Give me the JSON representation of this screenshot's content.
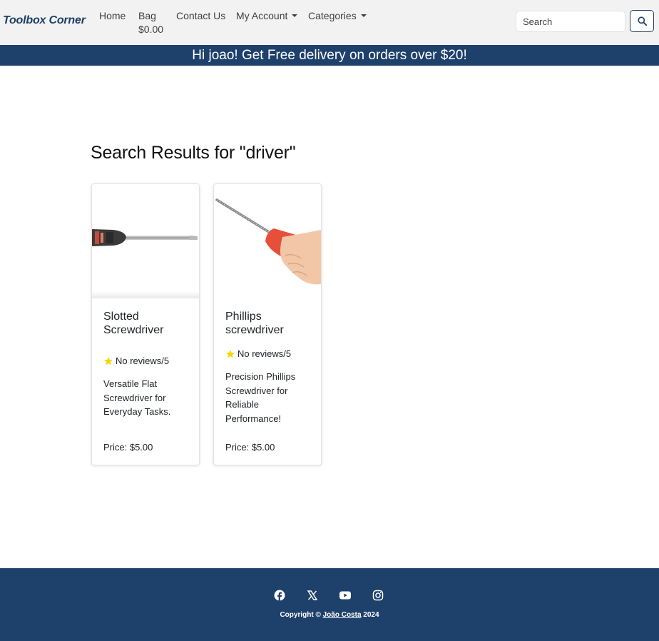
{
  "navbar": {
    "brand": "Toolbox Corner",
    "links": {
      "home": "Home",
      "bag": "Bag $0.00",
      "contact": "Contact Us",
      "account": "My Account",
      "categories": "Categories"
    },
    "search": {
      "placeholder": "Search",
      "value": ""
    }
  },
  "banner": {
    "text": "Hi joao! Get Free delivery on orders over $20!"
  },
  "main": {
    "title": "Search Results for \"driver\"",
    "products": [
      {
        "name": "Slotted Screwdriver",
        "rating": "No reviews/5",
        "description": "Versatile Flat Screwdriver for Everyday Tasks.",
        "price": "Price: $5.00"
      },
      {
        "name": "Phillips screwdriver",
        "rating": "No reviews/5",
        "description": "Precision Phillips Screwdriver for Reliable Performance!",
        "price": "Price: $5.00"
      }
    ]
  },
  "footer": {
    "icons": [
      "facebook-icon",
      "x-icon",
      "youtube-icon",
      "instagram-icon"
    ],
    "copyright_prefix": "Copyright ©",
    "author": "João Costa",
    "year": "2024"
  },
  "colors": {
    "brand": "#1e3f66",
    "banner": "#1e416c",
    "navbar": "#f2f2f2",
    "star": "#f5d800"
  }
}
